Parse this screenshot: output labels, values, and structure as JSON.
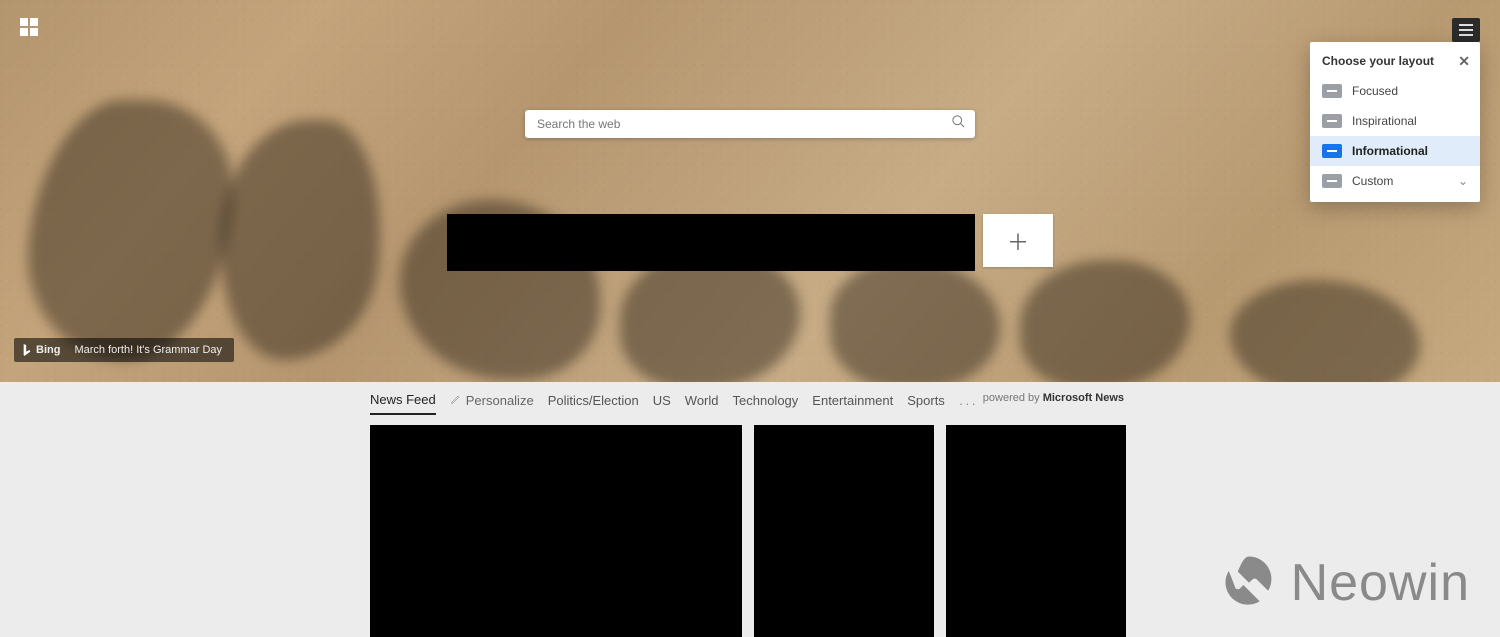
{
  "search": {
    "placeholder": "Search the web"
  },
  "bing": {
    "logo_text": "Bing",
    "caption": "March forth! It's Grammar Day"
  },
  "layout_panel": {
    "title": "Choose your layout",
    "items": {
      "focused": "Focused",
      "inspirational": "Inspirational",
      "informational": "Informational",
      "custom": "Custom"
    }
  },
  "feed": {
    "tabs": {
      "news_feed": "News Feed",
      "personalize": "Personalize",
      "politics": "Politics/Election",
      "us": "US",
      "world": "World",
      "technology": "Technology",
      "entertainment": "Entertainment",
      "sports": "Sports"
    },
    "source_prefix": "powered by ",
    "source_name": "Microsoft News"
  },
  "quicklinks": {
    "add_glyph": "＋"
  },
  "watermark": {
    "text": "Neowin"
  }
}
